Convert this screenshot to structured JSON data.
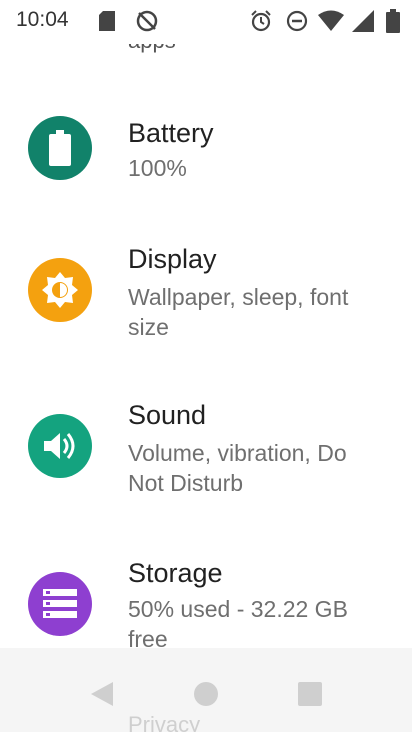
{
  "status_bar": {
    "time": "10:04"
  },
  "cut_off_top_item": {
    "text": "apps"
  },
  "settings": [
    {
      "title": "Battery",
      "subtitle": "100%",
      "icon": "battery-icon",
      "color": "#11826a"
    },
    {
      "title": "Display",
      "subtitle": "Wallpaper, sleep, font size",
      "icon": "brightness-icon",
      "color": "#f4a10f"
    },
    {
      "title": "Sound",
      "subtitle": "Volume, vibration, Do Not Disturb",
      "icon": "volume-icon",
      "color": "#14a37f"
    },
    {
      "title": "Storage",
      "subtitle": "50% used - 32.22 GB free",
      "icon": "storage-icon",
      "color": "#8e3fd0"
    }
  ],
  "cut_off_bottom_item": {
    "text": "Privacy"
  }
}
